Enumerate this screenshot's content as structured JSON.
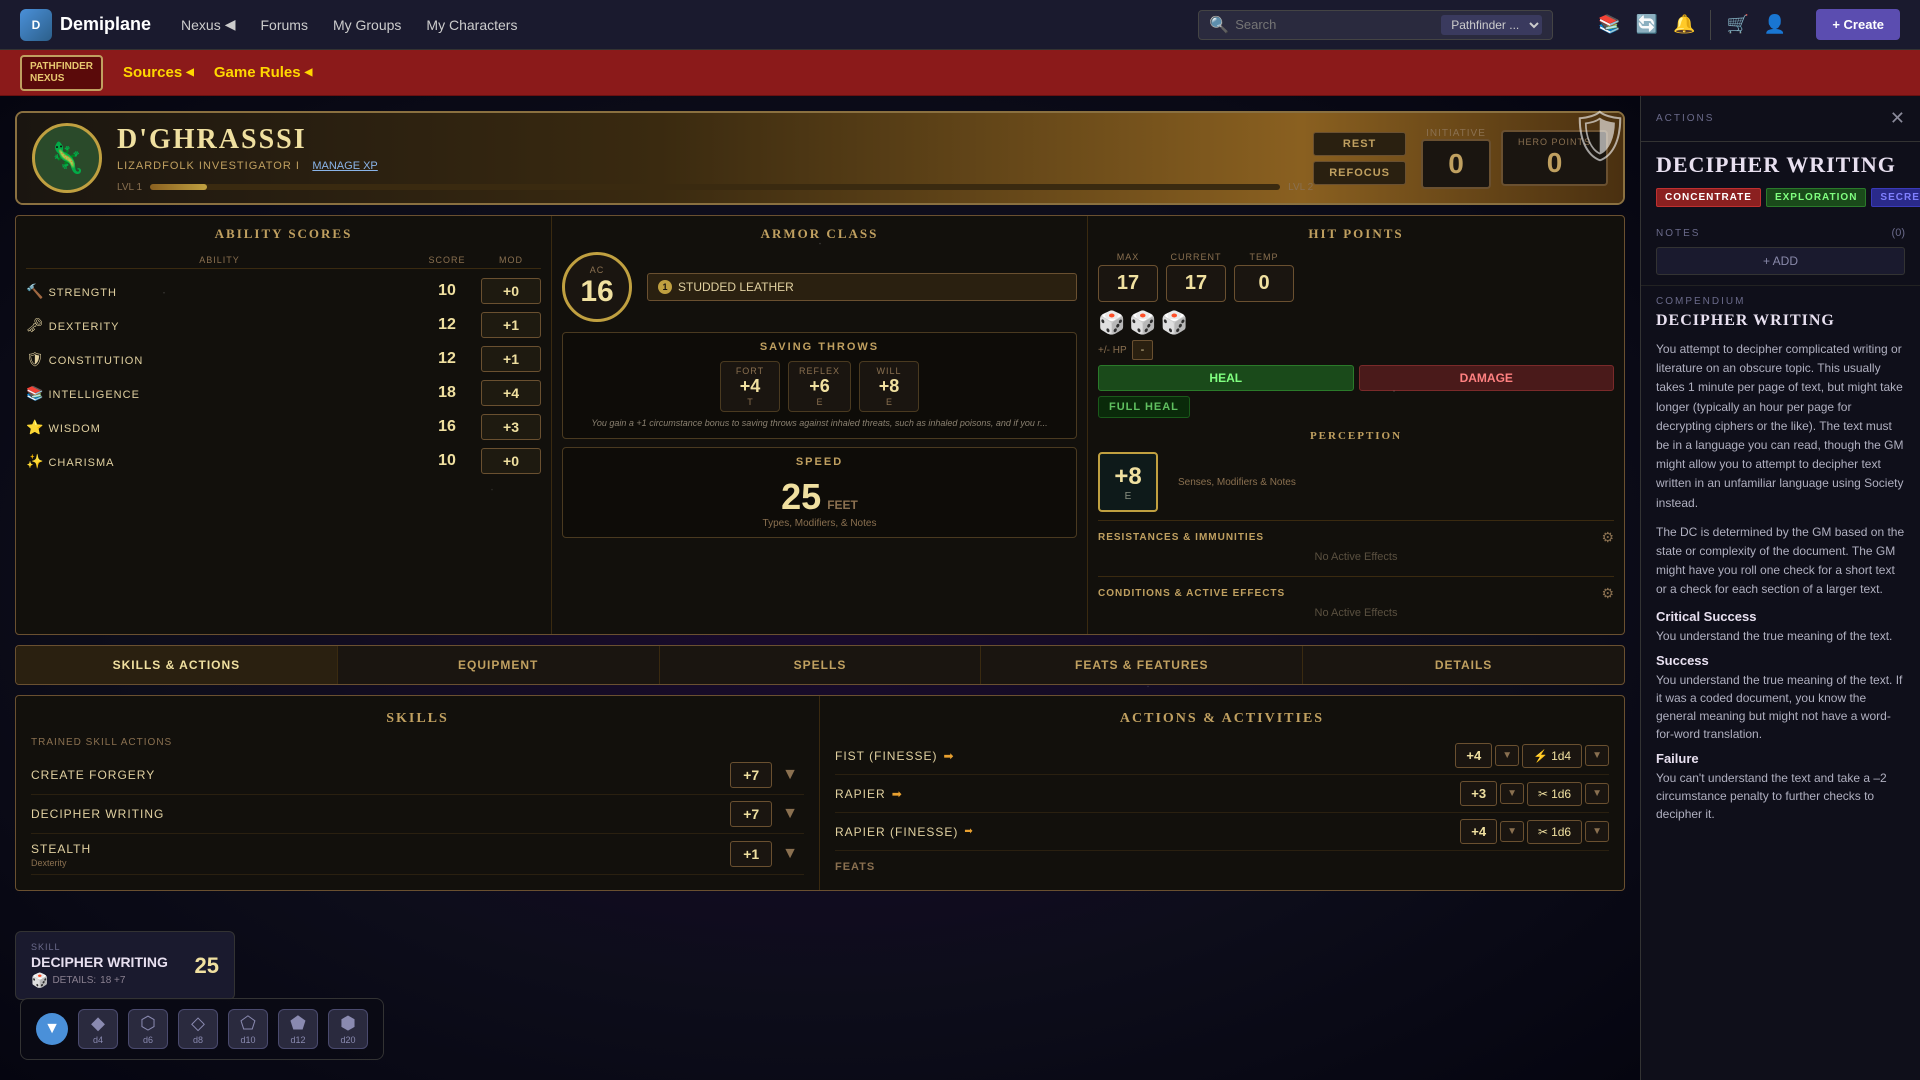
{
  "site": {
    "logo_text": "Demiplane",
    "logo_icon": "D"
  },
  "top_nav": {
    "nexus_label": "Nexus",
    "forums_label": "Forums",
    "my_groups_label": "My Groups",
    "my_characters_label": "My Characters",
    "search_placeholder": "Search",
    "search_filter": "Pathfinder ...",
    "create_label": "+ Create"
  },
  "second_nav": {
    "pf_logo_line1": "PATHFINDER",
    "pf_logo_line2": "NEXUS",
    "sources_label": "Sources",
    "game_rules_label": "Game Rules"
  },
  "character": {
    "name": "D'GHRASSSI",
    "class_race": "LIZARDFOLK INVESTIGATOR I",
    "manage_xp": "MANAGE XP",
    "level_left": "LVL 1",
    "level_right": "LVL 2",
    "rest_label": "REST",
    "refocus_label": "REFOCUS",
    "initiative_label": "INITIATIVE",
    "initiative_value": "0",
    "hero_points_label": "HERO POINTS",
    "hero_points_value": "0"
  },
  "ability_scores": {
    "title": "Ability Scores",
    "col_ability": "ABILITY",
    "col_score": "SCORE",
    "col_mod": "MOD",
    "abilities": [
      {
        "name": "STRENGTH",
        "icon": "🔨",
        "score": "10",
        "mod": "+0"
      },
      {
        "name": "DEXTERITY",
        "icon": "🗝",
        "score": "12",
        "mod": "+1"
      },
      {
        "name": "CONSTITUTION",
        "icon": "🛡",
        "score": "12",
        "mod": "+1"
      },
      {
        "name": "INTELLIGENCE",
        "icon": "📚",
        "score": "18",
        "mod": "+4"
      },
      {
        "name": "WISDOM",
        "icon": "⭐",
        "score": "16",
        "mod": "+3"
      },
      {
        "name": "CHARISMA",
        "icon": "✨",
        "score": "10",
        "mod": "+0"
      }
    ]
  },
  "armor_class": {
    "title": "Armor Class",
    "ac_label": "AC",
    "ac_value": "16",
    "armor_name": "STUDDED LEATHER",
    "armor_icon": "🛡"
  },
  "saving_throws": {
    "title": "Saving Throws",
    "fort_label": "FORT",
    "fort_value": "+4",
    "fort_prof": "T",
    "reflex_label": "REFLEX",
    "reflex_value": "+6",
    "reflex_prof": "E",
    "will_label": "WILL",
    "will_value": "+8",
    "will_prof": "E",
    "note": "You gain a +1 circumstance bonus to saving throws against inhaled threats, such as inhaled poisons, and if you r..."
  },
  "speed": {
    "title": "Speed",
    "value": "25",
    "unit": "FEET",
    "note": "Types, Modifiers, & Notes"
  },
  "hit_points": {
    "title": "Hit Points",
    "max_label": "MAX",
    "max_value": "17",
    "current_label": "CURRENT",
    "current_value": "17",
    "temp_label": "TEMP",
    "temp_value": "0",
    "adj_label": "+/- HP",
    "minus_label": "-",
    "heal_label": "HEAL",
    "damage_label": "DAMAGE",
    "full_heal_label": "FULL HEAL"
  },
  "perception": {
    "title": "PERCEPTION",
    "value": "+8",
    "proficiency": "E",
    "note": "Senses, Modifiers & Notes"
  },
  "resistances": {
    "title": "RESISTANCES & IMMUNITIES",
    "empty_text": "No Active Effects"
  },
  "conditions": {
    "title": "CONDITIONS & ACTIVE EFFECTS",
    "empty_text": "No Active Effects"
  },
  "tabs": [
    {
      "label": "Skills & Actions",
      "active": true
    },
    {
      "label": "Equipment",
      "active": false
    },
    {
      "label": "Spells",
      "active": false
    },
    {
      "label": "Feats & Features",
      "active": false
    },
    {
      "label": "Details",
      "active": false
    }
  ],
  "skills": {
    "title": "Skills",
    "subtitle": "TRAINED SKILL ACTIONS",
    "items": [
      {
        "name": "CREATE FORGERY",
        "sub": "",
        "bonus": "+7"
      },
      {
        "name": "DECIPHER WRITING",
        "sub": "",
        "bonus": "+7"
      },
      {
        "name": "STEALTH",
        "sub": "Dexterity",
        "bonus": "+1"
      }
    ]
  },
  "actions": {
    "title": "Actions & Activities",
    "items": [
      {
        "name": "FIST (FINESSE)",
        "bonus": "+4",
        "dice": "1d4",
        "dice_icon": "⚡"
      },
      {
        "name": "RAPIER",
        "bonus": "+3",
        "dice": "1d6",
        "dice_icon": "✂"
      },
      {
        "name": "RAPIER (FINESSE)",
        "bonus": "+4",
        "dice": "1d6",
        "dice_icon": "✂"
      }
    ],
    "feats_label": "FEATS"
  },
  "sidebar": {
    "actions_label": "ACTIONS",
    "title": "DECIPHER WRITING",
    "tags": [
      "CONCENTRATE",
      "EXPLORATION",
      "SECRET"
    ],
    "notes_label": "NOTES",
    "notes_count": "(0)",
    "add_note_label": "+ ADD",
    "compendium_label": "COMPENDIUM",
    "compendium_title": "DECIPHER WRITING",
    "description": "You attempt to decipher complicated writing or literature on an obscure topic. This usually takes 1 minute per page of text, but might take longer (typically an hour per page for decrypting ciphers or the like). The text must be in a language you can read, though the GM might allow you to attempt to decipher text written in an unfamiliar language using Society instead.",
    "dc_text": "The DC is determined by the GM based on the state or complexity of the document. The GM might have you roll one check for a short text or a check for each section of a larger text.",
    "results": [
      {
        "type": "Critical Success",
        "text": "You understand the true meaning of the text."
      },
      {
        "type": "Success",
        "text": "You understand the true meaning of the text. If it was a coded document, you know the general meaning but might not have a word-for-word translation."
      },
      {
        "type": "Failure",
        "text": "You can't understand the text and take a –2 circumstance penalty to further checks to decipher it."
      }
    ]
  },
  "skill_result": {
    "label": "SKILL",
    "name": "DECIPHER WRITING",
    "result": "25",
    "details_label": "DETAILS:",
    "details_value": "18 +7"
  },
  "dice_tray": {
    "toggle_icon": "▼",
    "dice": [
      "d4",
      "d6",
      "d8",
      "d10",
      "d12",
      "d20"
    ]
  }
}
